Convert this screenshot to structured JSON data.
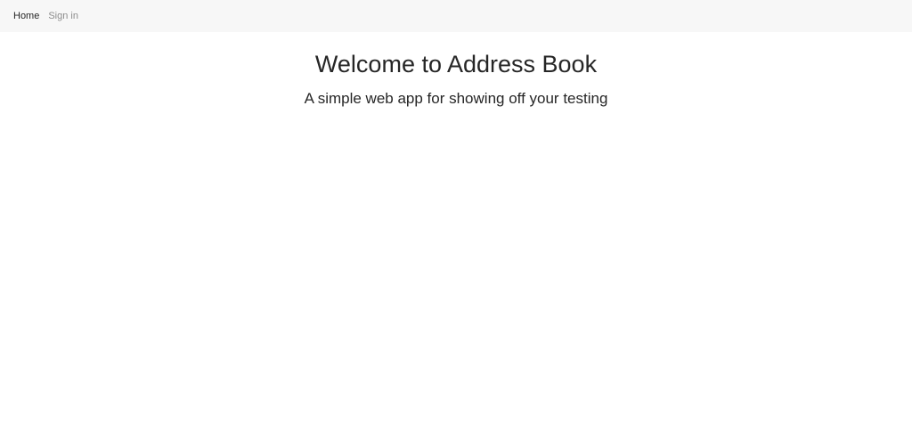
{
  "nav": {
    "home_label": "Home",
    "signin_label": "Sign in"
  },
  "main": {
    "title": "Welcome to Address Book",
    "subtitle": "A simple web app for showing off your testing"
  },
  "colors": {
    "navbar_bg": "#f7f7f7",
    "text_dark": "#262626",
    "text_muted": "#8c8c8c"
  }
}
